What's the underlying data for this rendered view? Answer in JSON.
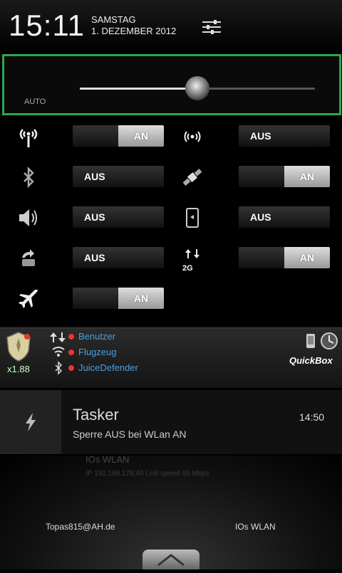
{
  "status_bar": {
    "time": "15:11",
    "day": "SAMSTAG",
    "date": "1. DEZEMBER 2012"
  },
  "brightness": {
    "auto_label": "AUTO",
    "level": 0.5
  },
  "toggles": [
    {
      "icon": "wifi-tethering-icon",
      "label": "AN",
      "state": "on"
    },
    {
      "icon": "wifi-hotspot-icon",
      "label": "AUS",
      "state": "off"
    },
    {
      "icon": "bluetooth-icon",
      "label": "AUS",
      "state": "off"
    },
    {
      "icon": "gps-satellite-icon",
      "label": "AN",
      "state": "on"
    },
    {
      "icon": "sound-icon",
      "label": "AUS",
      "state": "off"
    },
    {
      "icon": "auto-rotate-icon",
      "label": "AUS",
      "state": "off"
    },
    {
      "icon": "sync-icon",
      "label": "AUS",
      "state": "off"
    },
    {
      "icon": "mobile-data-2g-icon",
      "label": "AN",
      "state": "on",
      "sub": "2G"
    },
    {
      "icon": "airplane-icon",
      "label": "AN",
      "state": "on"
    }
  ],
  "juice_defender": {
    "multiplier": "x1.88",
    "items": [
      "Benutzer",
      "Flugzeug",
      "JuiceDefender"
    ],
    "quickbox_label": "QuickBox"
  },
  "tasker": {
    "title": "Tasker",
    "time": "14:50",
    "text": "Sperre AUS bei WLan AN"
  },
  "background": {
    "faint_line1": "IOs WLAN",
    "faint_line2": "IP 192.168.178.40 Link speed 65 Mbps"
  },
  "footer": {
    "carrier": "Topas815@AH.de",
    "ssid": "IOs WLAN"
  }
}
